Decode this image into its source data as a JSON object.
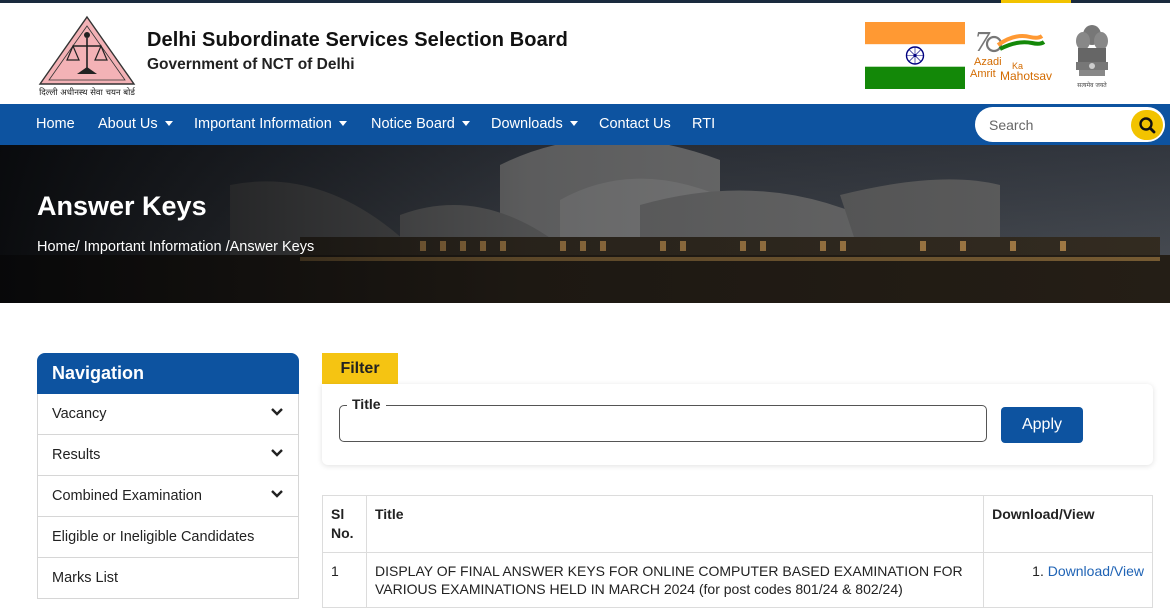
{
  "header": {
    "title": "Delhi Subordinate Services Selection Board",
    "subtitle": "Government of NCT of Delhi",
    "logo_caption": "दिल्ली अधीनस्थ सेवा चयन बोर्ड",
    "azadi_line1": "Azadi",
    "azadi_line2": "Amrit",
    "azadi_ka": "Ka",
    "azadi_line3": "Mahotsav",
    "emblem_caption": "सत्यमेव जयते"
  },
  "nav": {
    "items": [
      {
        "label": "Home",
        "dropdown": false
      },
      {
        "label": "About Us",
        "dropdown": true
      },
      {
        "label": "Important Information",
        "dropdown": true
      },
      {
        "label": "Notice Board",
        "dropdown": true
      },
      {
        "label": "Downloads",
        "dropdown": true
      },
      {
        "label": "Contact Us",
        "dropdown": false
      },
      {
        "label": "RTI",
        "dropdown": false
      }
    ],
    "search_placeholder": "Search"
  },
  "banner": {
    "title": "Answer Keys",
    "breadcrumb": "Home/ Important Information /Answer Keys"
  },
  "sidebar": {
    "heading": "Navigation",
    "items": [
      {
        "label": "Vacancy",
        "expandable": true
      },
      {
        "label": "Results",
        "expandable": true
      },
      {
        "label": "Combined Examination",
        "expandable": true
      },
      {
        "label": "Eligible or Ineligible Candidates",
        "expandable": false
      },
      {
        "label": "Marks List",
        "expandable": false
      }
    ]
  },
  "filter": {
    "tab_label": "Filter",
    "title_label": "Title",
    "title_value": "",
    "apply_label": "Apply"
  },
  "table": {
    "headers": [
      "Sl No.",
      "Title",
      "Download/View"
    ],
    "rows": [
      {
        "sl": "1",
        "title": "DISPLAY OF FINAL ANSWER KEYS FOR ONLINE COMPUTER BASED EXAMINATION FOR VARIOUS EXAMINATIONS HELD IN MARCH 2024 (for post codes 801/24 & 802/24)",
        "link_index": "1.",
        "link_label": "Download/View"
      }
    ]
  },
  "colors": {
    "nav_blue": "#0d53a0",
    "accent_yellow": "#f5c412",
    "link_blue": "#1f63b5"
  }
}
